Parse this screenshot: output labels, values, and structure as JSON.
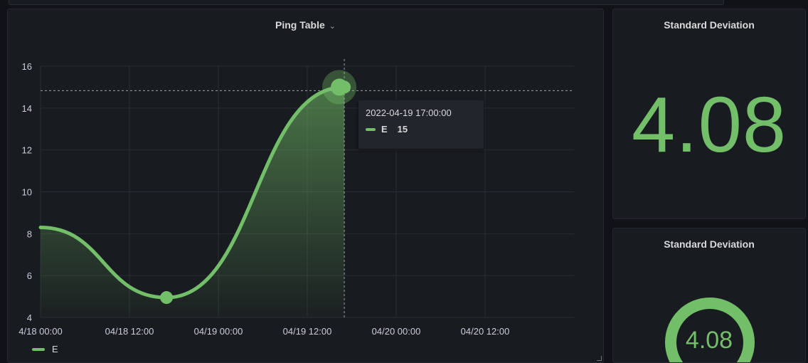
{
  "timeseries_panel": {
    "title": "Ping Table",
    "tooltip": {
      "time": "2022-04-19 17:00:00",
      "series": "E",
      "value": "15"
    },
    "legend": [
      {
        "name": "E",
        "color": "#73bf69"
      }
    ]
  },
  "stat_panel": {
    "title": "Standard Deviation",
    "value": "4.08"
  },
  "gauge_panel": {
    "title": "Standard Deviation",
    "value": "4.08",
    "fraction": 0.72
  },
  "colors": {
    "series": "#73bf69",
    "background": "#111217",
    "panel": "#181b1f"
  },
  "chart_data": {
    "type": "line",
    "title": "Ping Table",
    "x_ticks": [
      "4/18 00:00",
      "04/18 12:00",
      "04/19 00:00",
      "04/19 12:00",
      "04/20 00:00",
      "04/20 12:00"
    ],
    "x_tick_hours": [
      0,
      12,
      24,
      36,
      48,
      60
    ],
    "xlim_hours": [
      0,
      72
    ],
    "y_ticks": [
      4,
      6,
      8,
      10,
      12,
      14,
      16
    ],
    "ylim": [
      4,
      16
    ],
    "grid": true,
    "legend_position": "bottom-left",
    "series": [
      {
        "name": "E",
        "color": "#73bf69",
        "points": [
          {
            "x": "2022-04-18 00:00",
            "hours": 0,
            "y": 8.3
          },
          {
            "x": "2022-04-18 17:00",
            "hours": 17,
            "y": 4.95
          },
          {
            "x": "2022-04-19 17:00",
            "hours": 41,
            "y": 15
          }
        ]
      }
    ],
    "hover": {
      "x": "2022-04-19 17:00:00",
      "hours": 41,
      "y": 15
    }
  }
}
